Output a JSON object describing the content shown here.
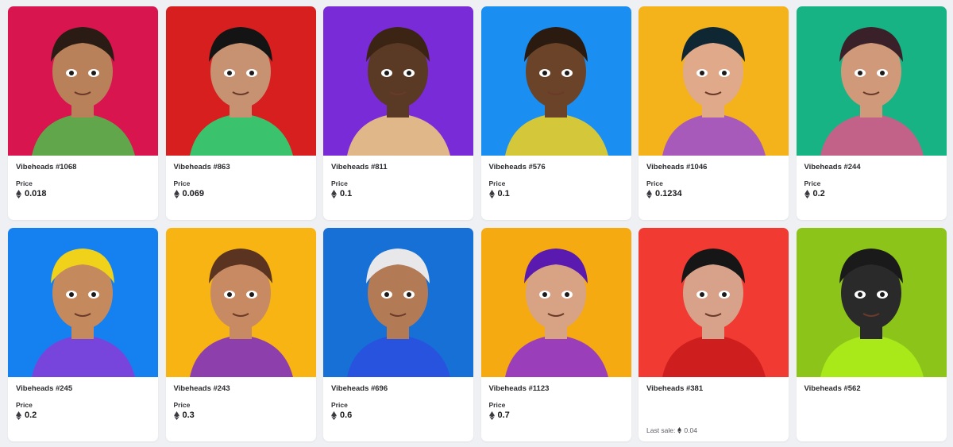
{
  "price_label": "Price",
  "cards": [
    {
      "name": "Vibeheads #1068",
      "price": "0.018",
      "bg": "#d8154f",
      "skin": "#b9815a",
      "accent": "#4cc04a",
      "hair": "#2a1c14"
    },
    {
      "name": "Vibeheads #863",
      "price": "0.069",
      "bg": "#d71f1f",
      "skin": "#c69272",
      "accent": "#1fe07a",
      "hair": "#141414"
    },
    {
      "name": "Vibeheads #811",
      "price": "0.1",
      "bg": "#7a2bd8",
      "skin": "#5a3a24",
      "accent": "#f2d07a",
      "hair": "#3b2414"
    },
    {
      "name": "Vibeheads #576",
      "price": "0.1",
      "bg": "#1b8ef2",
      "skin": "#6b4328",
      "accent": "#f5d21a",
      "hair": "#2a1a10"
    },
    {
      "name": "Vibeheads #1046",
      "price": "0.1234",
      "bg": "#f4b21b",
      "skin": "#e0a98a",
      "accent": "#9a4ad6",
      "hair": "#0f2733"
    },
    {
      "name": "Vibeheads #244",
      "price": "0.2",
      "bg": "#17b384",
      "skin": "#d09a7a",
      "accent": "#e0548a",
      "hair": "#3a2028"
    },
    {
      "name": "Vibeheads #245",
      "price": "0.2",
      "bg": "#1580f0",
      "skin": "#c48a5e",
      "accent": "#8a3bd8",
      "hair": "#f0d21a"
    },
    {
      "name": "Vibeheads #243",
      "price": "0.3",
      "bg": "#f7b412",
      "skin": "#c88a62",
      "accent": "#7a2bc8",
      "hair": "#5a3420"
    },
    {
      "name": "Vibeheads #696",
      "price": "0.6",
      "bg": "#1670d6",
      "skin": "#b27a55",
      "accent": "#2b4ee0",
      "hair": "#e8e8ea"
    },
    {
      "name": "Vibeheads #1123",
      "price": "0.7",
      "bg": "#f4aa10",
      "skin": "#d8a384",
      "accent": "#8a2bd8",
      "hair": "#5a1ab0"
    },
    {
      "name": "Vibeheads #381",
      "price": "",
      "last_sale_label": "Last sale:",
      "last_sale": "0.04",
      "bg": "#f03a32",
      "skin": "#d8a28a",
      "accent": "#c81a1a",
      "hair": "#161616"
    },
    {
      "name": "Vibeheads #562",
      "price": "",
      "bg": "#8cc41a",
      "skin": "#2a2a2a",
      "accent": "#aef01a",
      "hair": "#1a1a1a"
    }
  ]
}
